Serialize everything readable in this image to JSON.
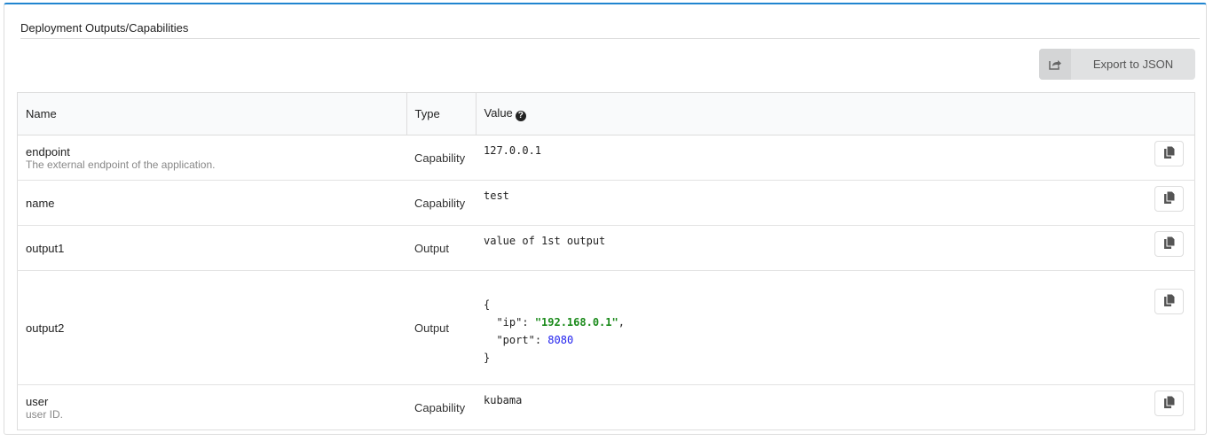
{
  "panel": {
    "title": "Deployment Outputs/Capabilities",
    "export_label": "Export to JSON"
  },
  "table": {
    "headers": {
      "name": "Name",
      "type": "Type",
      "value": "Value"
    },
    "rows": [
      {
        "name": "endpoint",
        "description": "The external endpoint of the application.",
        "type": "Capability",
        "value": "127.0.0.1"
      },
      {
        "name": "name",
        "type": "Capability",
        "value": "test"
      },
      {
        "name": "output1",
        "type": "Output",
        "value": "value of 1st output"
      },
      {
        "name": "output2",
        "type": "Output",
        "value_json": {
          "open": "{",
          "ip_key": "\"ip\"",
          "ip_value": "\"192.168.0.1\"",
          "port_key": "\"port\"",
          "port_value": "8080",
          "close": "}"
        }
      },
      {
        "name": "user",
        "description": "user ID.",
        "type": "Capability",
        "value": "kubama"
      }
    ]
  },
  "colors": {
    "accent": "#2185d0",
    "json_string": "#1a8a1a",
    "json_number": "#2222ee"
  }
}
